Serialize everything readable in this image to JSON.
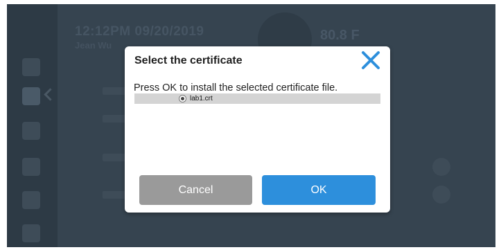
{
  "background": {
    "time_text": "12:12PM 09/20/2019",
    "sub_text": "Jean Wu",
    "temp_text": "80.8 F"
  },
  "dialog": {
    "title": "Select the certificate",
    "close_icon": "close-icon",
    "message": "Press OK to install the selected certificate file.",
    "files": [
      {
        "label": "lab1.crt",
        "selected": true
      }
    ],
    "cancel_label": "Cancel",
    "ok_label": "OK"
  },
  "colors": {
    "accent": "#2d8fdc",
    "cancel": "#9a9a9a",
    "backdrop": "#364450"
  }
}
